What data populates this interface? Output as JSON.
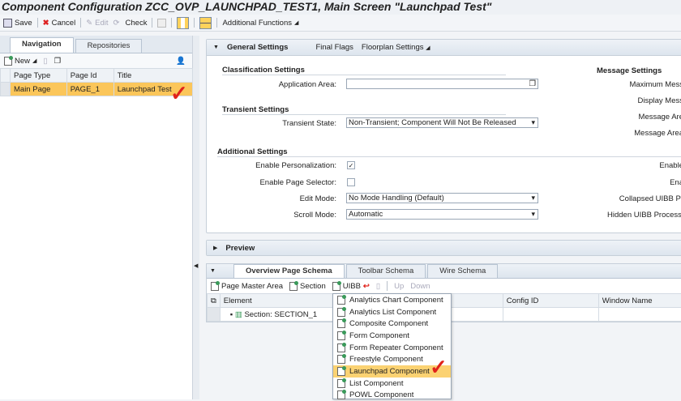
{
  "title": "Component Configuration ZCC_OVP_LAUNCHPAD_TEST1, Main Screen \"Launchpad Test\"",
  "toolbar": {
    "save": "Save",
    "cancel": "Cancel",
    "edit": "Edit",
    "check": "Check",
    "additional": "Additional Functions"
  },
  "left": {
    "tabs": [
      "Navigation",
      "Repositories"
    ],
    "new": "New",
    "columns": [
      "Page Type",
      "Page Id",
      "Title"
    ],
    "rows": [
      [
        "Main Page",
        "PAGE_1",
        "Launchpad Test"
      ]
    ]
  },
  "general": {
    "title": "General Settings",
    "final_flags": "Final Flags",
    "floorplan": "Floorplan Settings",
    "classification": "Classification Settings",
    "app_area_label": "Application Area:",
    "app_area_value": "",
    "transient": "Transient Settings",
    "transient_label": "Transient State:",
    "transient_value": "Non-Transient; Component Will Not Be Released",
    "additional": "Additional Settings",
    "personalization_label": "Enable Personalization:",
    "personalization_checked": true,
    "page_selector_label": "Enable Page Selector:",
    "page_selector_checked": false,
    "edit_mode_label": "Edit Mode:",
    "edit_mode_value": "No Mode Handling (Default)",
    "scroll_mode_label": "Scroll Mode:",
    "scroll_mode_value": "Automatic",
    "message": "Message Settings",
    "msg_labels": [
      "Maximum Mess",
      "Display Mess",
      "Message Are",
      "Message Area"
    ],
    "right_labels": [
      "Enable",
      "Ena",
      "Collapsed UIBB Pr",
      "Hidden UIBB Processi"
    ]
  },
  "preview": "Preview",
  "schema": {
    "tabs": [
      "Overview Page Schema",
      "Toolbar Schema",
      "Wire Schema"
    ],
    "page_master": "Page Master Area",
    "section": "Section",
    "uibb": "UIBB",
    "up": "Up",
    "down": "Down",
    "columns": [
      "Element",
      "Config ID",
      "Window Name"
    ],
    "row": "Section: SECTION_1"
  },
  "menu": {
    "items": [
      "Analytics Chart Component",
      "Analytics List Component",
      "Composite Component",
      "Form Component",
      "Form Repeater Component",
      "Freestyle Component",
      "Launchpad Component",
      "List Component",
      "POWL Component"
    ],
    "highlighted": 6
  },
  "check_mark": "✓"
}
